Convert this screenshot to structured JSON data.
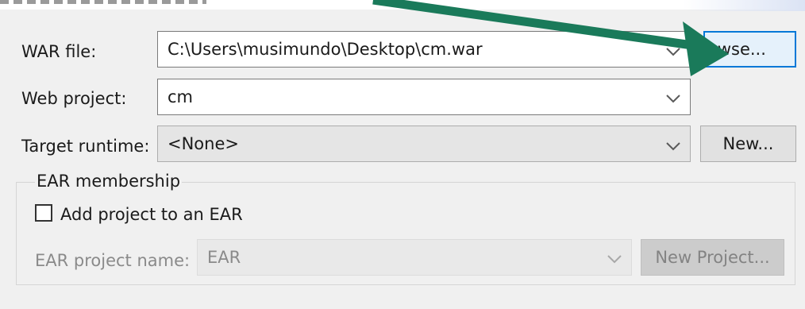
{
  "war_file": {
    "label": "WAR file:",
    "value": "C:\\Users\\musimundo\\Desktop\\cm.war",
    "browse_label": "owse..."
  },
  "web_project": {
    "label": "Web project:",
    "value": "cm"
  },
  "target_runtime": {
    "label": "Target runtime:",
    "value": "<None>",
    "new_label": "New..."
  },
  "ear_membership": {
    "group_label": "EAR membership",
    "checkbox_label": "Add project to an EAR",
    "checked": false,
    "project_name_label": "EAR project name:",
    "project_name_value": "EAR",
    "new_project_label": "New Project..."
  },
  "colors": {
    "annotation_arrow": "#1a7a5a",
    "focus_border": "#0078d7",
    "background": "#f0f0f0"
  }
}
